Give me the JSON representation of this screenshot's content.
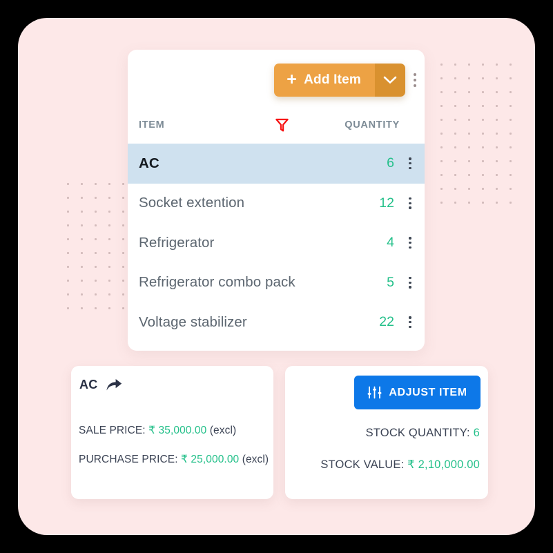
{
  "theme": {
    "frame_bg": "#fde8e8",
    "card_bg": "#ffffff",
    "accent_orange": "#eda244",
    "accent_orange_dark": "#d9912f",
    "accent_blue": "#0d78e8",
    "accent_green": "#24c08a",
    "selected_row_bg": "#cfe1ef",
    "filter_icon_color": "#f71111",
    "muted_text": "#7d8b96"
  },
  "list_card": {
    "toolbar": {
      "add_item_label": "Add Item",
      "add_item_plus": "+",
      "add_item_caret_icon": "chevron-down-icon",
      "overflow_icon": "kebab-menu-icon"
    },
    "table": {
      "columns": {
        "item": "ITEM",
        "quantity": "QUANTITY"
      },
      "filter_icon": "filter-funnel-icon",
      "rows": [
        {
          "name": "AC",
          "quantity": "6",
          "selected": true
        },
        {
          "name": "Socket extention",
          "quantity": "12",
          "selected": false
        },
        {
          "name": "Refrigerator",
          "quantity": "4",
          "selected": false
        },
        {
          "name": "Refrigerator combo pack",
          "quantity": "5",
          "selected": false
        },
        {
          "name": "Voltage stabilizer",
          "quantity": "22",
          "selected": false
        }
      ],
      "row_overflow_icon": "kebab-menu-icon"
    }
  },
  "item_detail_card": {
    "title": "AC",
    "share_icon": "share-arrow-icon",
    "sale_price": {
      "label": "SALE PRICE:",
      "amount": "₹ 35,000.00",
      "suffix": "(excl)"
    },
    "purchase_price": {
      "label": "PURCHASE PRICE:",
      "amount": "₹ 25,000.00",
      "suffix": "(excl)"
    }
  },
  "stock_detail_card": {
    "adjust_button": {
      "label": "ADJUST ITEM",
      "icon": "sliders-icon"
    },
    "stock_quantity": {
      "label": "STOCK QUANTITY:",
      "value": "6"
    },
    "stock_value": {
      "label": "STOCK VALUE:",
      "value": "₹ 2,10,000.00"
    }
  },
  "decor": {
    "dots_right": {
      "cols": 6,
      "rows": 11
    },
    "dots_left": {
      "cols": 6,
      "rows": 10
    }
  }
}
